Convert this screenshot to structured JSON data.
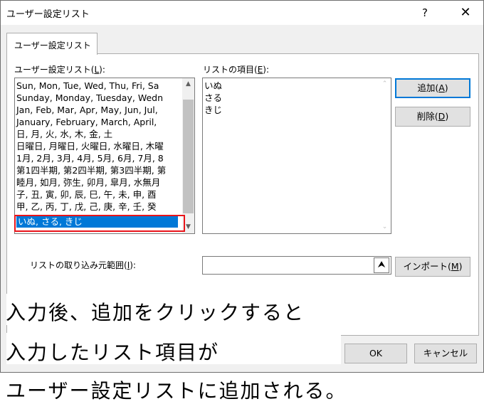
{
  "window": {
    "title": "ユーザー設定リスト",
    "help": "?",
    "close": "✕"
  },
  "tab": {
    "label": "ユーザー設定リスト"
  },
  "lists": {
    "label_pre": "ユーザー設定リスト(",
    "label_key": "L",
    "label_post": "):",
    "items": [
      "Sun, Mon, Tue, Wed, Thu, Fri, Sa",
      "Sunday, Monday, Tuesday, Wedn",
      "Jan, Feb, Mar, Apr, May, Jun, Jul,",
      "January, February, March, April,",
      "日, 月, 火, 水, 木, 金, 土",
      "日曜日, 月曜日, 火曜日, 水曜日, 木曜",
      "1月, 2月, 3月, 4月, 5月, 6月, 7月, 8",
      "第1四半期, 第2四半期, 第3四半期, 第",
      "睦月, 如月, 弥生, 卯月, 皐月, 水無月",
      "子, 丑, 寅, 卯, 辰, 巳, 午, 未, 申, 酉",
      "甲, 乙, 丙, 丁, 戊, 己, 庚, 辛, 壬, 癸"
    ],
    "selected": "いぬ, さる, きじ"
  },
  "entries": {
    "label_pre": "リストの項目(",
    "label_key": "E",
    "label_post": "):",
    "items": [
      "いぬ",
      "さる",
      "きじ"
    ]
  },
  "buttons": {
    "add_pre": "追加(",
    "add_key": "A",
    "add_post": ")",
    "delete_pre": "削除(",
    "delete_key": "D",
    "delete_post": ")",
    "import_pre": "インポート(",
    "import_key": "M",
    "import_post": ")",
    "ok": "OK",
    "cancel": "キャンセル"
  },
  "import_range": {
    "label_pre": "リストの取り込み元範囲(",
    "label_key": "I",
    "label_post": "):",
    "value": "",
    "collapse": "⮝"
  },
  "annotations": {
    "line1": "入力後、追加をクリックすると",
    "line2": "入力したリスト項目が",
    "line3": "ユーザー設定リストに追加される。"
  }
}
